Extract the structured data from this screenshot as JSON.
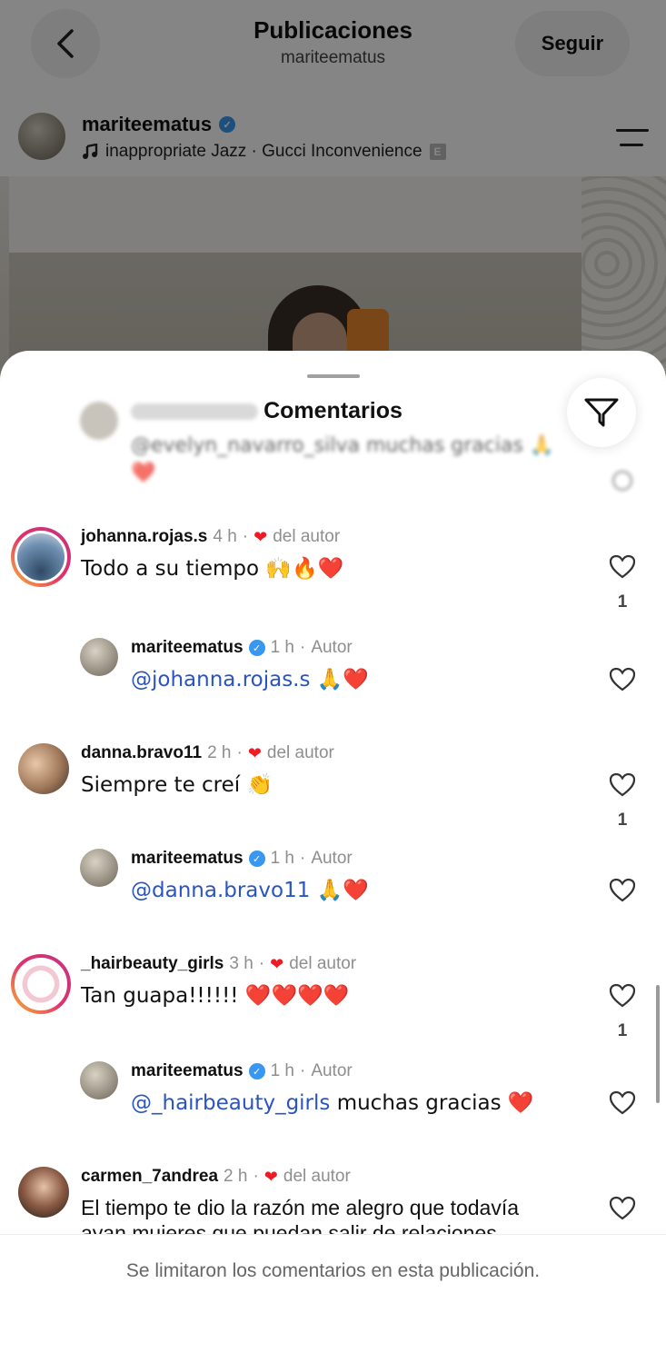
{
  "header": {
    "title": "Publicaciones",
    "subtitle": "mariteematus",
    "follow_label": "Seguir"
  },
  "post": {
    "username": "mariteematus",
    "music": "inappropriate Jazz · Gucci Inconvenience",
    "explicit_badge": "E"
  },
  "sheet": {
    "title": "Comentarios",
    "faded_comment_text": "@evelyn_navarro_silva muchas gracias 🙏 ❤️",
    "footer_text": "Se limitaron los comentarios en esta publicación."
  },
  "comments": [
    {
      "username": "johanna.rojas.s",
      "time": "4 h",
      "author_like": "del autor",
      "text": "Todo a su tiempo 🙌🔥❤️",
      "like_count": "1",
      "reply": {
        "username": "mariteematus",
        "time": "1 h",
        "role": "Autor",
        "mention": "@johanna.rojas.s",
        "text": "🙏❤️"
      }
    },
    {
      "username": "danna.bravo11",
      "time": "2 h",
      "author_like": "del autor",
      "text": "Siempre te creí 👏",
      "like_count": "1",
      "reply": {
        "username": "mariteematus",
        "time": "1 h",
        "role": "Autor",
        "mention": "@danna.bravo11",
        "text": "🙏❤️"
      }
    },
    {
      "username": "_hairbeauty_girls",
      "time": "3 h",
      "author_like": "del autor",
      "text": "Tan guapa!!!!!! ❤️❤️❤️❤️",
      "like_count": "1",
      "reply": {
        "username": "mariteematus",
        "time": "1 h",
        "role": "Autor",
        "mention": "@_hairbeauty_girls",
        "text": "muchas gracias ❤️"
      }
    },
    {
      "username": "carmen_7andrea",
      "time": "2 h",
      "author_like": "del autor",
      "text": "El tiempo te dio la razón me alegro que todavía",
      "text_line2": "ayan mujeres que puedan salir de relaciones"
    }
  ],
  "colors": {
    "mention": "#2a54c2",
    "heart": "#ed1c24",
    "verified": "#3897f0"
  }
}
